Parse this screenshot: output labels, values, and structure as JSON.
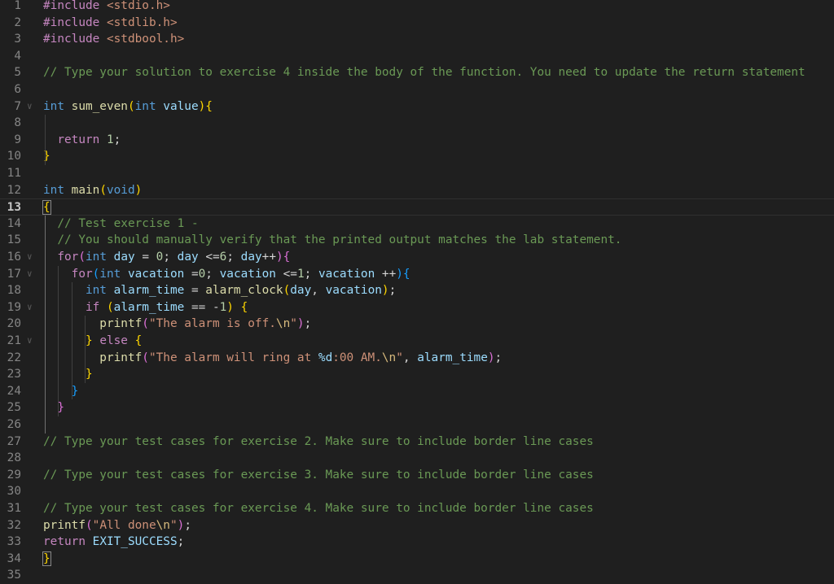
{
  "editor": {
    "language": "c",
    "active_line": 13,
    "theme_colors": {
      "background": "#1f1f1f",
      "keyword": "#569cd6",
      "control": "#c586c0",
      "function": "#dcdcaa",
      "variable": "#9cdcfe",
      "string": "#ce9178",
      "number": "#b5cea8",
      "comment": "#6a9955",
      "bracket_level1": "#ffd700",
      "bracket_level2": "#da70d6",
      "bracket_level3": "#179fff"
    },
    "lines": [
      {
        "n": "1",
        "tokens": [
          {
            "t": "#include ",
            "c": "pre"
          },
          {
            "t": "<stdio.h>",
            "c": "inc"
          }
        ]
      },
      {
        "n": "2",
        "tokens": [
          {
            "t": "#include ",
            "c": "pre"
          },
          {
            "t": "<stdlib.h>",
            "c": "inc"
          }
        ]
      },
      {
        "n": "3",
        "tokens": [
          {
            "t": "#include ",
            "c": "pre"
          },
          {
            "t": "<stdbool.h>",
            "c": "inc"
          }
        ]
      },
      {
        "n": "4",
        "tokens": []
      },
      {
        "n": "5",
        "tokens": [
          {
            "t": "// Type your solution to exercise 4 inside the body of the function. You need to update the return statement",
            "c": "cm"
          }
        ]
      },
      {
        "n": "6",
        "tokens": []
      },
      {
        "n": "7",
        "fold": true,
        "tokens": [
          {
            "t": "int ",
            "c": "kw"
          },
          {
            "t": "sum_even",
            "c": "fn"
          },
          {
            "t": "(",
            "c": "b1"
          },
          {
            "t": "int ",
            "c": "kw"
          },
          {
            "t": "value",
            "c": "var"
          },
          {
            "t": ")",
            "c": "b1"
          },
          {
            "t": "{",
            "c": "b1"
          }
        ]
      },
      {
        "n": "8",
        "tokens": []
      },
      {
        "n": "9",
        "tokens": [
          {
            "t": "  return ",
            "c": "ctl"
          },
          {
            "t": "1",
            "c": "num"
          },
          {
            "t": ";",
            "c": "plain"
          }
        ]
      },
      {
        "n": "10",
        "tokens": [
          {
            "t": "}",
            "c": "b1"
          }
        ]
      },
      {
        "n": "11",
        "tokens": []
      },
      {
        "n": "12",
        "tokens": [
          {
            "t": "int ",
            "c": "kw"
          },
          {
            "t": "main",
            "c": "fn"
          },
          {
            "t": "(",
            "c": "b1"
          },
          {
            "t": "void",
            "c": "kw"
          },
          {
            "t": ")",
            "c": "b1"
          }
        ]
      },
      {
        "n": "13",
        "tokens": [
          {
            "t": "{",
            "c": "b1",
            "box": true
          }
        ]
      },
      {
        "n": "14",
        "tokens": [
          {
            "t": "  // Test exercise 1 -",
            "c": "cm"
          }
        ]
      },
      {
        "n": "15",
        "tokens": [
          {
            "t": "  // You should manually verify that the printed output matches the lab statement.",
            "c": "cm"
          }
        ]
      },
      {
        "n": "16",
        "fold": true,
        "tokens": [
          {
            "t": "  for",
            "c": "ctl"
          },
          {
            "t": "(",
            "c": "b2"
          },
          {
            "t": "int ",
            "c": "kw"
          },
          {
            "t": "day",
            "c": "var"
          },
          {
            "t": " = ",
            "c": "plain"
          },
          {
            "t": "0",
            "c": "num"
          },
          {
            "t": "; ",
            "c": "plain"
          },
          {
            "t": "day",
            "c": "var"
          },
          {
            "t": " <=",
            "c": "plain"
          },
          {
            "t": "6",
            "c": "num"
          },
          {
            "t": "; ",
            "c": "plain"
          },
          {
            "t": "day",
            "c": "var"
          },
          {
            "t": "++",
            "c": "plain"
          },
          {
            "t": ")",
            "c": "b2"
          },
          {
            "t": "{",
            "c": "b2"
          }
        ]
      },
      {
        "n": "17",
        "fold": true,
        "tokens": [
          {
            "t": "    for",
            "c": "ctl"
          },
          {
            "t": "(",
            "c": "b3"
          },
          {
            "t": "int ",
            "c": "kw"
          },
          {
            "t": "vacation",
            "c": "var"
          },
          {
            "t": " =",
            "c": "plain"
          },
          {
            "t": "0",
            "c": "num"
          },
          {
            "t": "; ",
            "c": "plain"
          },
          {
            "t": "vacation",
            "c": "var"
          },
          {
            "t": " <=",
            "c": "plain"
          },
          {
            "t": "1",
            "c": "num"
          },
          {
            "t": "; ",
            "c": "plain"
          },
          {
            "t": "vacation",
            "c": "var"
          },
          {
            "t": " ++",
            "c": "plain"
          },
          {
            "t": ")",
            "c": "b3"
          },
          {
            "t": "{",
            "c": "b3"
          }
        ]
      },
      {
        "n": "18",
        "tokens": [
          {
            "t": "      int ",
            "c": "kw"
          },
          {
            "t": "alarm_time",
            "c": "var"
          },
          {
            "t": " = ",
            "c": "plain"
          },
          {
            "t": "alarm_clock",
            "c": "fn"
          },
          {
            "t": "(",
            "c": "b1"
          },
          {
            "t": "day",
            "c": "var"
          },
          {
            "t": ", ",
            "c": "plain"
          },
          {
            "t": "vacation",
            "c": "var"
          },
          {
            "t": ")",
            "c": "b1"
          },
          {
            "t": ";",
            "c": "plain"
          }
        ]
      },
      {
        "n": "19",
        "fold": true,
        "tokens": [
          {
            "t": "      if ",
            "c": "ctl"
          },
          {
            "t": "(",
            "c": "b1"
          },
          {
            "t": "alarm_time",
            "c": "var"
          },
          {
            "t": " == -",
            "c": "plain"
          },
          {
            "t": "1",
            "c": "num"
          },
          {
            "t": ")",
            "c": "b1"
          },
          {
            "t": " {",
            "c": "b1"
          }
        ]
      },
      {
        "n": "20",
        "tokens": [
          {
            "t": "        printf",
            "c": "fn"
          },
          {
            "t": "(",
            "c": "b2"
          },
          {
            "t": "\"The alarm is off.",
            "c": "str"
          },
          {
            "t": "\\n",
            "c": "esc"
          },
          {
            "t": "\"",
            "c": "str"
          },
          {
            "t": ")",
            "c": "b2"
          },
          {
            "t": ";",
            "c": "plain"
          }
        ]
      },
      {
        "n": "21",
        "fold": true,
        "tokens": [
          {
            "t": "      }",
            "c": "b1"
          },
          {
            "t": " else ",
            "c": "ctl"
          },
          {
            "t": "{",
            "c": "b1"
          }
        ]
      },
      {
        "n": "22",
        "tokens": [
          {
            "t": "        printf",
            "c": "fn"
          },
          {
            "t": "(",
            "c": "b2"
          },
          {
            "t": "\"The alarm will ring at ",
            "c": "str"
          },
          {
            "t": "%d",
            "c": "var"
          },
          {
            "t": ":00 AM.",
            "c": "str"
          },
          {
            "t": "\\n",
            "c": "esc"
          },
          {
            "t": "\"",
            "c": "str"
          },
          {
            "t": ", ",
            "c": "plain"
          },
          {
            "t": "alarm_time",
            "c": "var"
          },
          {
            "t": ")",
            "c": "b2"
          },
          {
            "t": ";",
            "c": "plain"
          }
        ]
      },
      {
        "n": "23",
        "tokens": [
          {
            "t": "      }",
            "c": "b1"
          }
        ]
      },
      {
        "n": "24",
        "tokens": [
          {
            "t": "    }",
            "c": "b3"
          }
        ]
      },
      {
        "n": "25",
        "tokens": [
          {
            "t": "  }",
            "c": "b2"
          }
        ]
      },
      {
        "n": "26",
        "tokens": []
      },
      {
        "n": "27",
        "tokens": [
          {
            "t": "// Type your test cases for exercise 2. Make sure to include border line cases",
            "c": "cm"
          }
        ]
      },
      {
        "n": "28",
        "tokens": []
      },
      {
        "n": "29",
        "tokens": [
          {
            "t": "// Type your test cases for exercise 3. Make sure to include border line cases",
            "c": "cm"
          }
        ]
      },
      {
        "n": "30",
        "tokens": []
      },
      {
        "n": "31",
        "tokens": [
          {
            "t": "// Type your test cases for exercise 4. Make sure to include border line cases",
            "c": "cm"
          }
        ]
      },
      {
        "n": "32",
        "tokens": [
          {
            "t": "printf",
            "c": "fn"
          },
          {
            "t": "(",
            "c": "b2"
          },
          {
            "t": "\"All done",
            "c": "str"
          },
          {
            "t": "\\n",
            "c": "esc"
          },
          {
            "t": "\"",
            "c": "str"
          },
          {
            "t": ")",
            "c": "b2"
          },
          {
            "t": ";",
            "c": "plain"
          }
        ]
      },
      {
        "n": "33",
        "tokens": [
          {
            "t": "return ",
            "c": "ctl"
          },
          {
            "t": "EXIT_SUCCESS",
            "c": "var"
          },
          {
            "t": ";",
            "c": "plain"
          }
        ]
      },
      {
        "n": "34",
        "tokens": [
          {
            "t": "}",
            "c": "b1",
            "box": true
          }
        ]
      },
      {
        "n": "35",
        "tokens": []
      }
    ]
  }
}
